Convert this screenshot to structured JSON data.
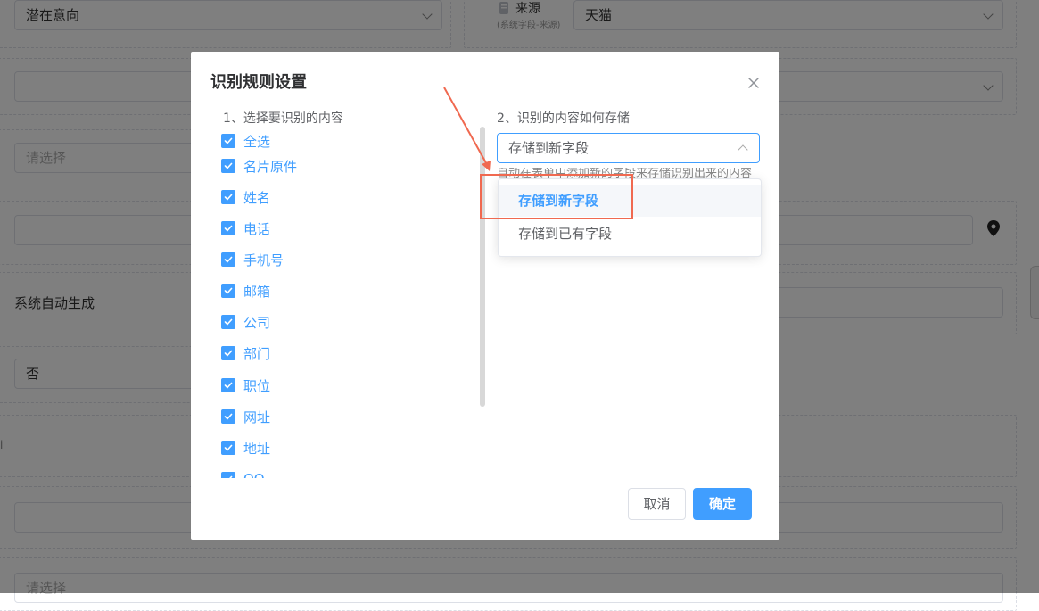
{
  "background_form": {
    "intent_select_value": "潜在意向",
    "source_label": "来源",
    "source_sublabel": "(系统字段-来源)",
    "source_select_value": "天猫",
    "select_placeholder": "请选择",
    "auto_generate_text": "系统自动生成",
    "yes_no_value": "否",
    "bottom_select_placeholder": "请选择",
    "edge_fragment": "i"
  },
  "modal": {
    "title": "识别规则设置",
    "section1_title": "1、选择要识别的内容",
    "section2_title": "2、识别的内容如何存储",
    "checkbox_items": [
      {
        "label": "全选",
        "checked": true
      },
      {
        "label": "名片原件",
        "checked": true
      },
      {
        "label": "姓名",
        "checked": true
      },
      {
        "label": "电话",
        "checked": true
      },
      {
        "label": "手机号",
        "checked": true
      },
      {
        "label": "邮箱",
        "checked": true
      },
      {
        "label": "公司",
        "checked": true
      },
      {
        "label": "部门",
        "checked": true
      },
      {
        "label": "职位",
        "checked": true
      },
      {
        "label": "网址",
        "checked": true
      },
      {
        "label": "地址",
        "checked": true
      },
      {
        "label": "QQ",
        "checked": true
      }
    ],
    "storage_select": {
      "value": "存储到新字段",
      "hint": "自动在表单中添加新的字段来存储识别出来的内容",
      "options": [
        "存储到新字段",
        "存储到已有字段"
      ],
      "selected_index": 0
    },
    "buttons": {
      "cancel": "取消",
      "confirm": "确定"
    }
  },
  "colors": {
    "primary": "#409eff",
    "annotation_red": "#f06950",
    "overlay": "rgba(0,0,0,0.5)"
  },
  "icons": [
    "close-icon",
    "check-icon",
    "chevron-up-icon",
    "chevron-down-icon",
    "location-pin-icon",
    "document-icon",
    "annotation-arrow"
  ]
}
